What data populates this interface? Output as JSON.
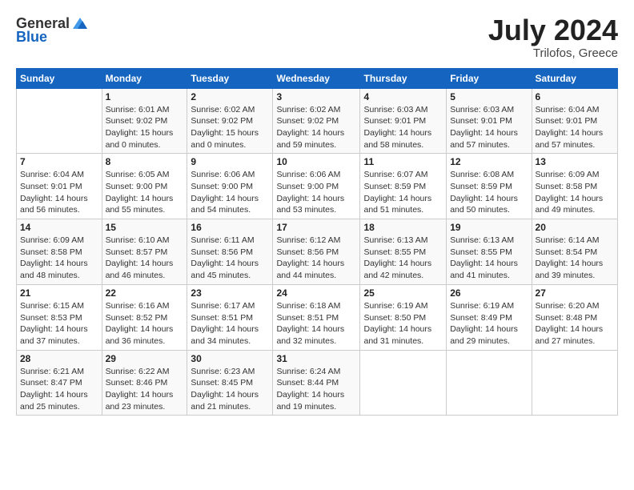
{
  "header": {
    "logo_general": "General",
    "logo_blue": "Blue",
    "title": "July 2024",
    "location": "Trilofos, Greece"
  },
  "weekdays": [
    "Sunday",
    "Monday",
    "Tuesday",
    "Wednesday",
    "Thursday",
    "Friday",
    "Saturday"
  ],
  "weeks": [
    [
      {
        "day": "",
        "info": ""
      },
      {
        "day": "1",
        "info": "Sunrise: 6:01 AM\nSunset: 9:02 PM\nDaylight: 15 hours\nand 0 minutes."
      },
      {
        "day": "2",
        "info": "Sunrise: 6:02 AM\nSunset: 9:02 PM\nDaylight: 15 hours\nand 0 minutes."
      },
      {
        "day": "3",
        "info": "Sunrise: 6:02 AM\nSunset: 9:02 PM\nDaylight: 14 hours\nand 59 minutes."
      },
      {
        "day": "4",
        "info": "Sunrise: 6:03 AM\nSunset: 9:01 PM\nDaylight: 14 hours\nand 58 minutes."
      },
      {
        "day": "5",
        "info": "Sunrise: 6:03 AM\nSunset: 9:01 PM\nDaylight: 14 hours\nand 57 minutes."
      },
      {
        "day": "6",
        "info": "Sunrise: 6:04 AM\nSunset: 9:01 PM\nDaylight: 14 hours\nand 57 minutes."
      }
    ],
    [
      {
        "day": "7",
        "info": "Sunrise: 6:04 AM\nSunset: 9:01 PM\nDaylight: 14 hours\nand 56 minutes."
      },
      {
        "day": "8",
        "info": "Sunrise: 6:05 AM\nSunset: 9:00 PM\nDaylight: 14 hours\nand 55 minutes."
      },
      {
        "day": "9",
        "info": "Sunrise: 6:06 AM\nSunset: 9:00 PM\nDaylight: 14 hours\nand 54 minutes."
      },
      {
        "day": "10",
        "info": "Sunrise: 6:06 AM\nSunset: 9:00 PM\nDaylight: 14 hours\nand 53 minutes."
      },
      {
        "day": "11",
        "info": "Sunrise: 6:07 AM\nSunset: 8:59 PM\nDaylight: 14 hours\nand 51 minutes."
      },
      {
        "day": "12",
        "info": "Sunrise: 6:08 AM\nSunset: 8:59 PM\nDaylight: 14 hours\nand 50 minutes."
      },
      {
        "day": "13",
        "info": "Sunrise: 6:09 AM\nSunset: 8:58 PM\nDaylight: 14 hours\nand 49 minutes."
      }
    ],
    [
      {
        "day": "14",
        "info": "Sunrise: 6:09 AM\nSunset: 8:58 PM\nDaylight: 14 hours\nand 48 minutes."
      },
      {
        "day": "15",
        "info": "Sunrise: 6:10 AM\nSunset: 8:57 PM\nDaylight: 14 hours\nand 46 minutes."
      },
      {
        "day": "16",
        "info": "Sunrise: 6:11 AM\nSunset: 8:56 PM\nDaylight: 14 hours\nand 45 minutes."
      },
      {
        "day": "17",
        "info": "Sunrise: 6:12 AM\nSunset: 8:56 PM\nDaylight: 14 hours\nand 44 minutes."
      },
      {
        "day": "18",
        "info": "Sunrise: 6:13 AM\nSunset: 8:55 PM\nDaylight: 14 hours\nand 42 minutes."
      },
      {
        "day": "19",
        "info": "Sunrise: 6:13 AM\nSunset: 8:55 PM\nDaylight: 14 hours\nand 41 minutes."
      },
      {
        "day": "20",
        "info": "Sunrise: 6:14 AM\nSunset: 8:54 PM\nDaylight: 14 hours\nand 39 minutes."
      }
    ],
    [
      {
        "day": "21",
        "info": "Sunrise: 6:15 AM\nSunset: 8:53 PM\nDaylight: 14 hours\nand 37 minutes."
      },
      {
        "day": "22",
        "info": "Sunrise: 6:16 AM\nSunset: 8:52 PM\nDaylight: 14 hours\nand 36 minutes."
      },
      {
        "day": "23",
        "info": "Sunrise: 6:17 AM\nSunset: 8:51 PM\nDaylight: 14 hours\nand 34 minutes."
      },
      {
        "day": "24",
        "info": "Sunrise: 6:18 AM\nSunset: 8:51 PM\nDaylight: 14 hours\nand 32 minutes."
      },
      {
        "day": "25",
        "info": "Sunrise: 6:19 AM\nSunset: 8:50 PM\nDaylight: 14 hours\nand 31 minutes."
      },
      {
        "day": "26",
        "info": "Sunrise: 6:19 AM\nSunset: 8:49 PM\nDaylight: 14 hours\nand 29 minutes."
      },
      {
        "day": "27",
        "info": "Sunrise: 6:20 AM\nSunset: 8:48 PM\nDaylight: 14 hours\nand 27 minutes."
      }
    ],
    [
      {
        "day": "28",
        "info": "Sunrise: 6:21 AM\nSunset: 8:47 PM\nDaylight: 14 hours\nand 25 minutes."
      },
      {
        "day": "29",
        "info": "Sunrise: 6:22 AM\nSunset: 8:46 PM\nDaylight: 14 hours\nand 23 minutes."
      },
      {
        "day": "30",
        "info": "Sunrise: 6:23 AM\nSunset: 8:45 PM\nDaylight: 14 hours\nand 21 minutes."
      },
      {
        "day": "31",
        "info": "Sunrise: 6:24 AM\nSunset: 8:44 PM\nDaylight: 14 hours\nand 19 minutes."
      },
      {
        "day": "",
        "info": ""
      },
      {
        "day": "",
        "info": ""
      },
      {
        "day": "",
        "info": ""
      }
    ]
  ]
}
